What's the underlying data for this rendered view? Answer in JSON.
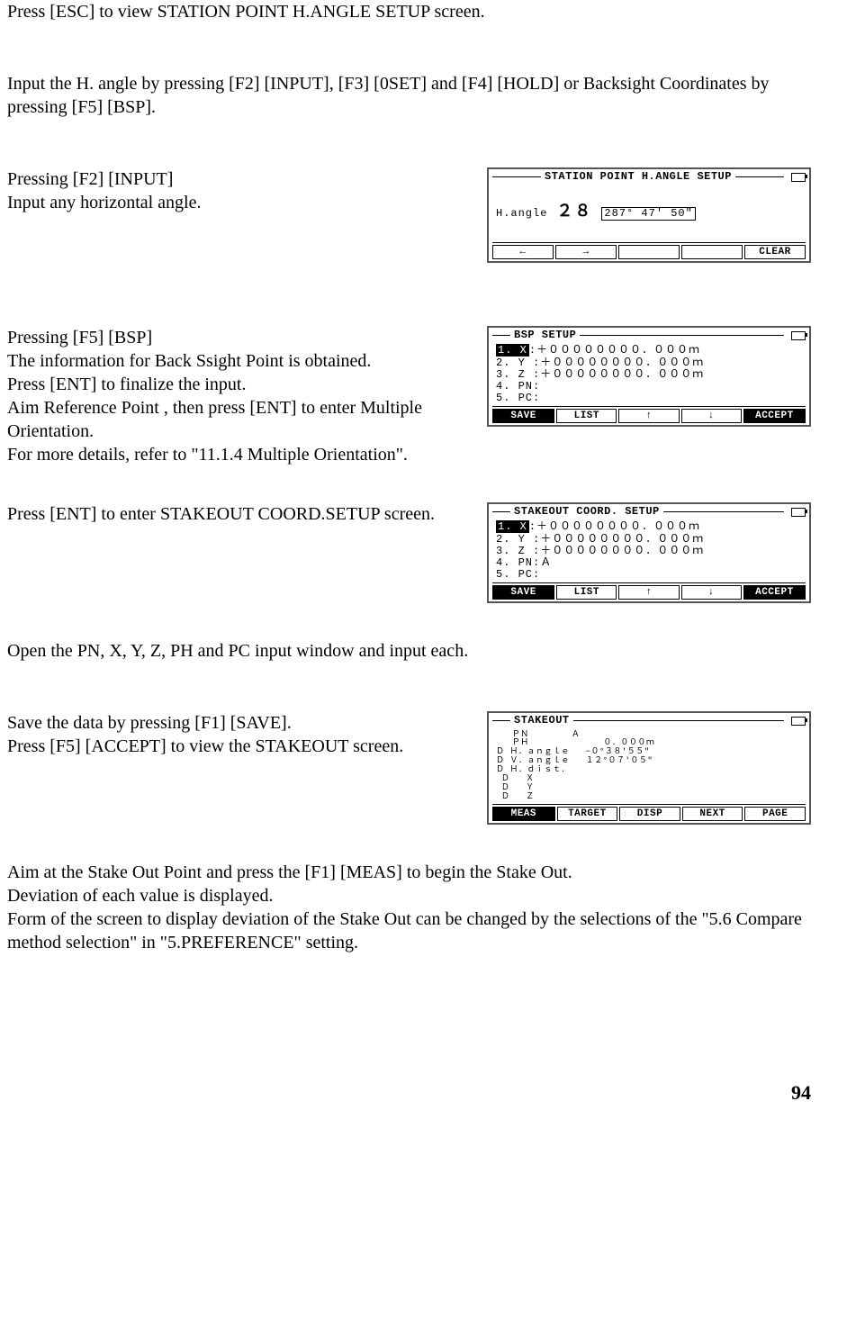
{
  "p1": "Press [ESC] to view STATION POINT H.ANGLE SETUP screen.",
  "p2": "Input the H. angle by pressing [F2] [INPUT], [F3] [0SET] and [F4] [HOLD] or Backsight Coordinates by pressing [F5] [BSP].",
  "s1_l1": "Pressing [F2] [INPUT]",
  "s1_l2": "Input any horizontal angle.",
  "lcd1": {
    "title": "STATION POINT H.ANGLE SETUP",
    "label": "H.angle",
    "big": "２８",
    "val": "287° 47′ 50″",
    "fn": [
      "←",
      "→",
      "",
      "",
      "CLEAR"
    ]
  },
  "s2_l1": "Pressing [F5]  [BSP]",
  "s2_l2": "The information for Back Ssight Point is obtained.",
  "s2_l3": "Press [ENT] to finalize the input.",
  "s2_l4": "Aim Reference Point , then press [ENT] to enter Multiple Orientation.",
  "s2_l5": "For more details, refer to \"11.1.4 Multiple Orientation\".",
  "lcd2": {
    "title": "BSP SETUP",
    "rows": [
      {
        "k": "1. X",
        "v": ":＋００００００００．０００ｍ",
        "inv": true
      },
      {
        "k": "2. Y ",
        "v": ":＋００００００００．０００ｍ"
      },
      {
        "k": "3. Z ",
        "v": ":＋００００００００．０００ｍ"
      },
      {
        "k": "4. PN",
        "v": ":"
      },
      {
        "k": "5. PC",
        "v": ":"
      }
    ],
    "fn": [
      "SAVE",
      "LIST",
      "↑",
      "↓",
      "ACCEPT"
    ],
    "fnInv": [
      true,
      false,
      false,
      false,
      true
    ]
  },
  "s3": "Press [ENT] to enter STAKEOUT COORD.SETUP screen.",
  "lcd3": {
    "title": "STAKEOUT COORD. SETUP",
    "rows": [
      {
        "k": "1. X",
        "v": ":＋００００００００．０００ｍ",
        "inv": true
      },
      {
        "k": "2. Y ",
        "v": ":＋００００００００．０００ｍ"
      },
      {
        "k": "3. Z ",
        "v": ":＋００００００００．０００ｍ"
      },
      {
        "k": "4. PN",
        "v": ":Ａ"
      },
      {
        "k": "5. PC",
        "v": ":"
      }
    ],
    "fn": [
      "SAVE",
      "LIST",
      "↑",
      "↓",
      "ACCEPT"
    ],
    "fnInv": [
      true,
      false,
      false,
      false,
      true
    ]
  },
  "p3": "Open the PN, X, Y, Z, PH and PC input window and input each.",
  "s4_l1": "Save the data by pressing [F1] [SAVE].",
  "s4_l2": "Press  [F5]  [ACCEPT] to view the STAKEOUT screen.",
  "lcd4": {
    "title": "STAKEOUT",
    "lines": [
      "   ＰＮ        Ａ",
      "   ＰＨ              ０．０００ｍ",
      "Ｄ Ｈ．ａｎｇｌｅ   −０°３８′５５″",
      "Ｄ Ｖ．ａｎｇｌｅ   １２°０７′０５″",
      "Ｄ Ｈ．ｄｉｓｔ．",
      " Ｄ   Ｘ",
      " Ｄ   Ｙ",
      " Ｄ   Ｚ"
    ],
    "fn": [
      "MEAS",
      "TARGET",
      "DISP",
      "NEXT",
      "PAGE"
    ],
    "fnInv": [
      true,
      false,
      false,
      false,
      false
    ]
  },
  "p4_l1": "Aim at the Stake Out Point and press the [F1] [MEAS] to begin the Stake Out.",
  "p4_l2": "Deviation of each value is displayed.",
  "p4_l3": "Form of the screen to display deviation of the Stake Out can be changed by the selections of the \"5.6 Compare method selection\" in \"5.PREFERENCE\" setting.",
  "page_num": "94"
}
